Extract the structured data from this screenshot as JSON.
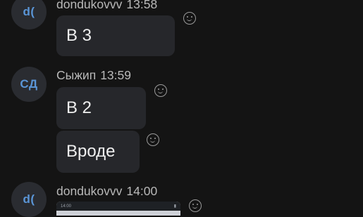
{
  "messages": [
    {
      "avatar": "d(",
      "author": "dondukovvv",
      "time": "13:58",
      "bubbles": [
        "В 3"
      ]
    },
    {
      "avatar": "СД",
      "author": "Сыжип",
      "time": "13:59",
      "bubbles": [
        "В 2",
        "Вроде"
      ]
    },
    {
      "avatar": "d(",
      "author": "dondukovvv",
      "time": "14:00",
      "attachment": {
        "status_left": "14:00",
        "status_right": "▮"
      }
    }
  ],
  "icons": {
    "reaction": "smiley-reaction-icon"
  },
  "colors": {
    "background": "#141414",
    "bubble": "#26272b",
    "avatar_bg": "#2a2c31",
    "avatar_text": "#5a95d6"
  }
}
